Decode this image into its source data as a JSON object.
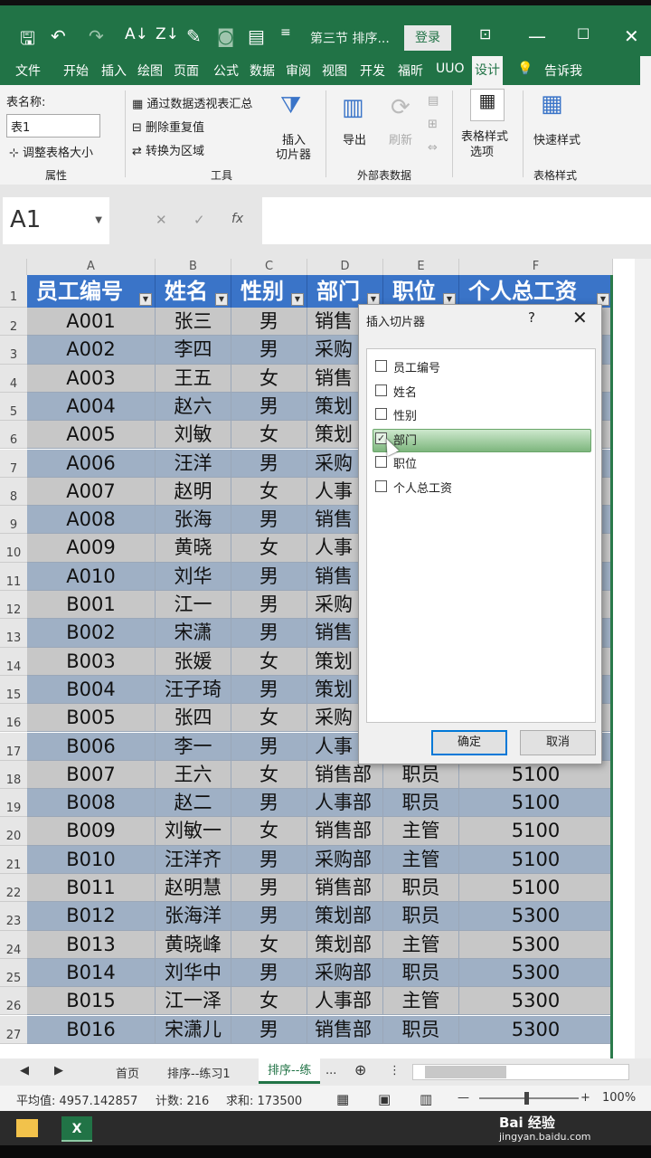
{
  "window": {
    "title": "第三节 排序...",
    "login": "登录"
  },
  "tabs": [
    "文件",
    "开始",
    "插入",
    "绘图",
    "页面",
    "公式",
    "数据",
    "审阅",
    "视图",
    "开发",
    "福昕",
    "UUO",
    "设计",
    "告诉我"
  ],
  "ribbon": {
    "table_name_label": "表名称:",
    "table_name_value": "表1",
    "resize_table": "调整表格大小",
    "properties_group": "属性",
    "pivot_summary": "通过数据透视表汇总",
    "remove_duplicates": "删除重复值",
    "convert_range": "转换为区域",
    "insert_slicer_1": "插入",
    "insert_slicer_2": "切片器",
    "tools_group": "工具",
    "export": "导出",
    "refresh": "刷新",
    "external_group": "外部表数据",
    "style_options_1": "表格样式",
    "style_options_2": "选项",
    "quick_styles": "快速样式",
    "styles_group": "表格样式"
  },
  "formula_bar": {
    "name_box": "A1",
    "fx": "fx"
  },
  "columns": [
    "A",
    "B",
    "C",
    "D",
    "E",
    "F"
  ],
  "headers": [
    "员工编号",
    "姓名",
    "性别",
    "部门",
    "职位",
    "个人总工资"
  ],
  "rows": [
    [
      "A001",
      "张三",
      "男",
      "销售",
      "",
      ""
    ],
    [
      "A002",
      "李四",
      "男",
      "采购",
      "",
      ""
    ],
    [
      "A003",
      "王五",
      "女",
      "销售",
      "",
      ""
    ],
    [
      "A004",
      "赵六",
      "男",
      "策划",
      "",
      ""
    ],
    [
      "A005",
      "刘敏",
      "女",
      "策划",
      "",
      ""
    ],
    [
      "A006",
      "汪洋",
      "男",
      "采购",
      "",
      ""
    ],
    [
      "A007",
      "赵明",
      "女",
      "人事",
      "",
      ""
    ],
    [
      "A008",
      "张海",
      "男",
      "销售",
      "",
      ""
    ],
    [
      "A009",
      "黄晓",
      "女",
      "人事",
      "",
      ""
    ],
    [
      "A010",
      "刘华",
      "男",
      "销售",
      "",
      ""
    ],
    [
      "B001",
      "江一",
      "男",
      "采购",
      "",
      ""
    ],
    [
      "B002",
      "宋潇",
      "男",
      "销售",
      "",
      ""
    ],
    [
      "B003",
      "张媛",
      "女",
      "策划",
      "",
      ""
    ],
    [
      "B004",
      "汪子琦",
      "男",
      "策划",
      "",
      ""
    ],
    [
      "B005",
      "张四",
      "女",
      "采购",
      "",
      ""
    ],
    [
      "B006",
      "李一",
      "男",
      "人事",
      "",
      ""
    ],
    [
      "B007",
      "王六",
      "女",
      "销售部",
      "职员",
      "5100"
    ],
    [
      "B008",
      "赵二",
      "男",
      "人事部",
      "职员",
      "5100"
    ],
    [
      "B009",
      "刘敏一",
      "女",
      "销售部",
      "主管",
      "5100"
    ],
    [
      "B010",
      "汪洋齐",
      "男",
      "采购部",
      "主管",
      "5100"
    ],
    [
      "B011",
      "赵明慧",
      "男",
      "销售部",
      "职员",
      "5100"
    ],
    [
      "B012",
      "张海洋",
      "男",
      "策划部",
      "职员",
      "5300"
    ],
    [
      "B013",
      "黄晓峰",
      "女",
      "策划部",
      "主管",
      "5300"
    ],
    [
      "B014",
      "刘华中",
      "男",
      "采购部",
      "职员",
      "5300"
    ],
    [
      "B015",
      "江一泽",
      "女",
      "人事部",
      "主管",
      "5300"
    ],
    [
      "B016",
      "宋潇儿",
      "男",
      "销售部",
      "职员",
      "5300"
    ]
  ],
  "dialog": {
    "title": "插入切片器",
    "help": "?",
    "close": "✕",
    "fields": [
      {
        "label": "员工编号",
        "checked": false
      },
      {
        "label": "姓名",
        "checked": false
      },
      {
        "label": "性别",
        "checked": false
      },
      {
        "label": "部门",
        "checked": true
      },
      {
        "label": "职位",
        "checked": false
      },
      {
        "label": "个人总工资",
        "checked": false
      }
    ],
    "ok": "确定",
    "cancel": "取消"
  },
  "sheets": [
    "首页",
    "排序--练习1",
    "排序--练"
  ],
  "sheet_more": "...",
  "status": {
    "average": "平均值: 4957.142857",
    "count": "计数: 216",
    "sum": "求和: 173500",
    "zoom": "100%"
  },
  "watermark": {
    "brand": "Bai 经验",
    "url": "jingyan.baidu.com"
  },
  "colors": {
    "excel_green": "#217346",
    "header_blue": "#3a74c8",
    "band_light": "#c7c7c7",
    "band_dark": "#9fb0c5"
  }
}
